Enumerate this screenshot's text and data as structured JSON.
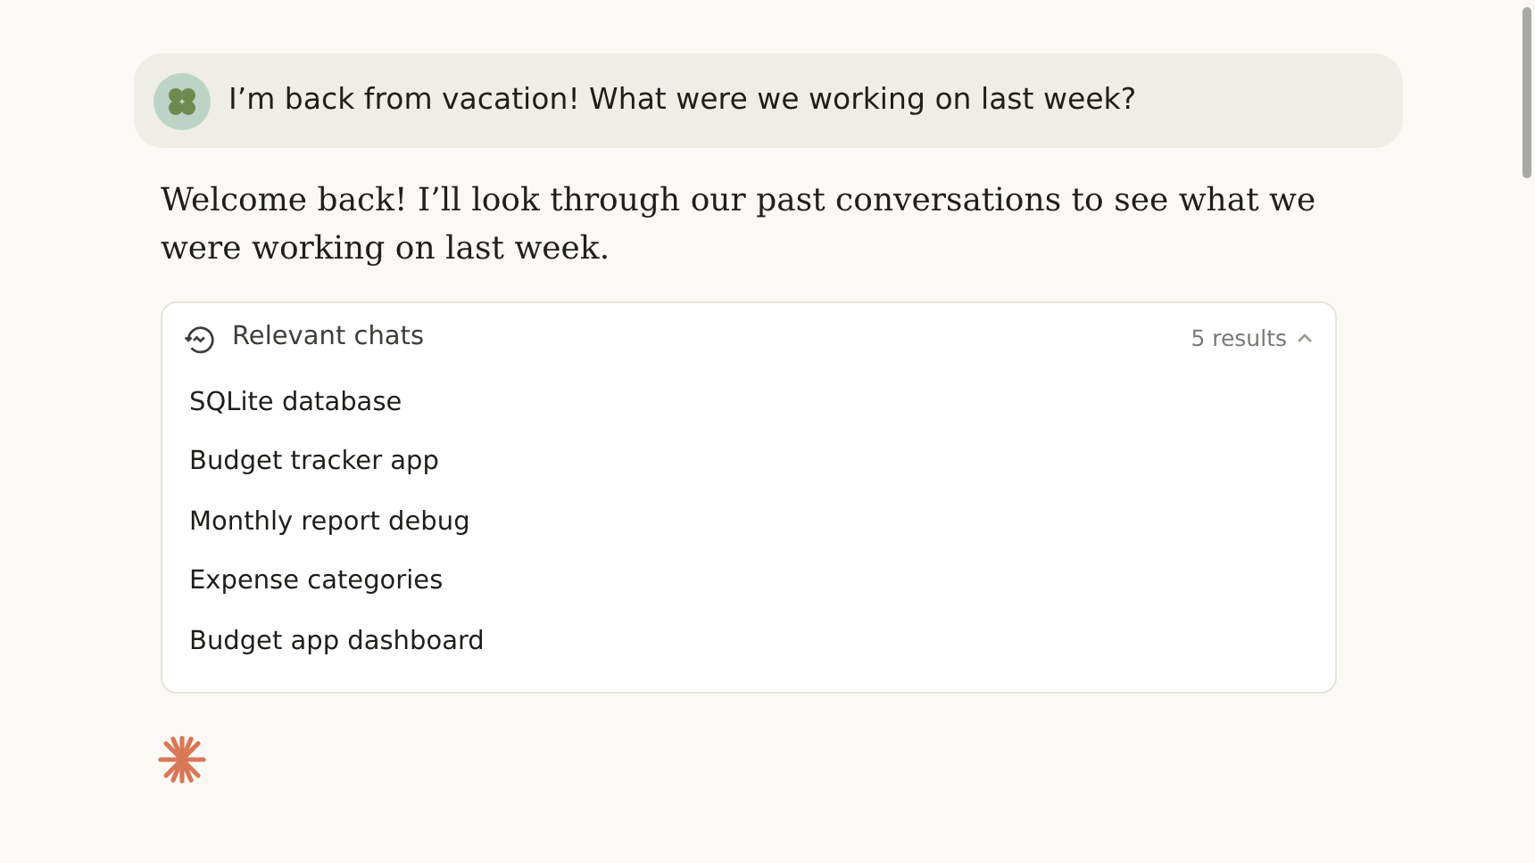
{
  "user_message": {
    "text": "I’m back from vacation! What were we working on last week?"
  },
  "assistant_message": {
    "text": "Welcome back! I’ll look through our past conversations to see what we were working on last week."
  },
  "relevant_chats": {
    "title": "Relevant chats",
    "count": "5 results",
    "expanded": true,
    "items": [
      {
        "title": "SQLite database"
      },
      {
        "title": "Budget tracker app"
      },
      {
        "title": "Monthly report debug"
      },
      {
        "title": "Expense categories"
      },
      {
        "title": "Budget app dashboard"
      }
    ]
  }
}
